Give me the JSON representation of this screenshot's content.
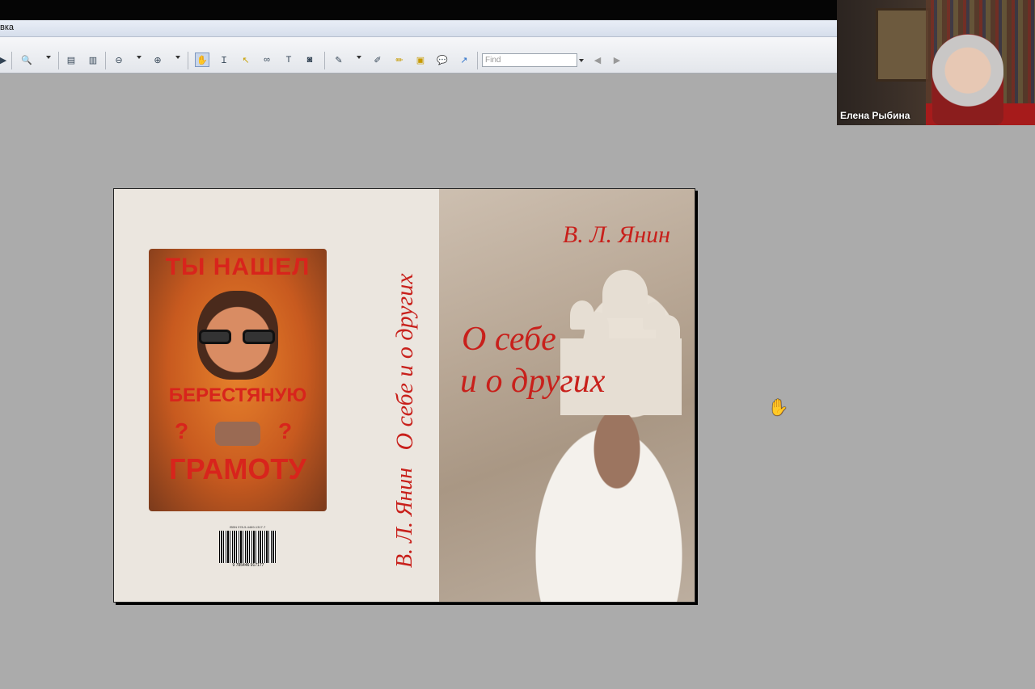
{
  "menu": {
    "fragment": "вка"
  },
  "toolbar": {
    "find_placeholder": "Find"
  },
  "webcam": {
    "participant_name": "Елена Рыбина"
  },
  "book": {
    "poster_line1": "ТЫ НАШЕЛ",
    "poster_line2": "БЕРЕСТЯНУЮ",
    "poster_line3": "ГРАМОТУ",
    "poster_q": "?",
    "isbn": "ISBN 978-5-4469-1317-7",
    "barcode_digits": "9 785446 917177",
    "spine_title": "О себе и о других",
    "spine_author": "В. Л. Янин",
    "front_author": "В. Л. Янин",
    "front_title_line1": "О себе",
    "front_title_line2": "и о других"
  },
  "colors": {
    "title_red": "#c8201b",
    "canvas_gray": "#ababab"
  }
}
